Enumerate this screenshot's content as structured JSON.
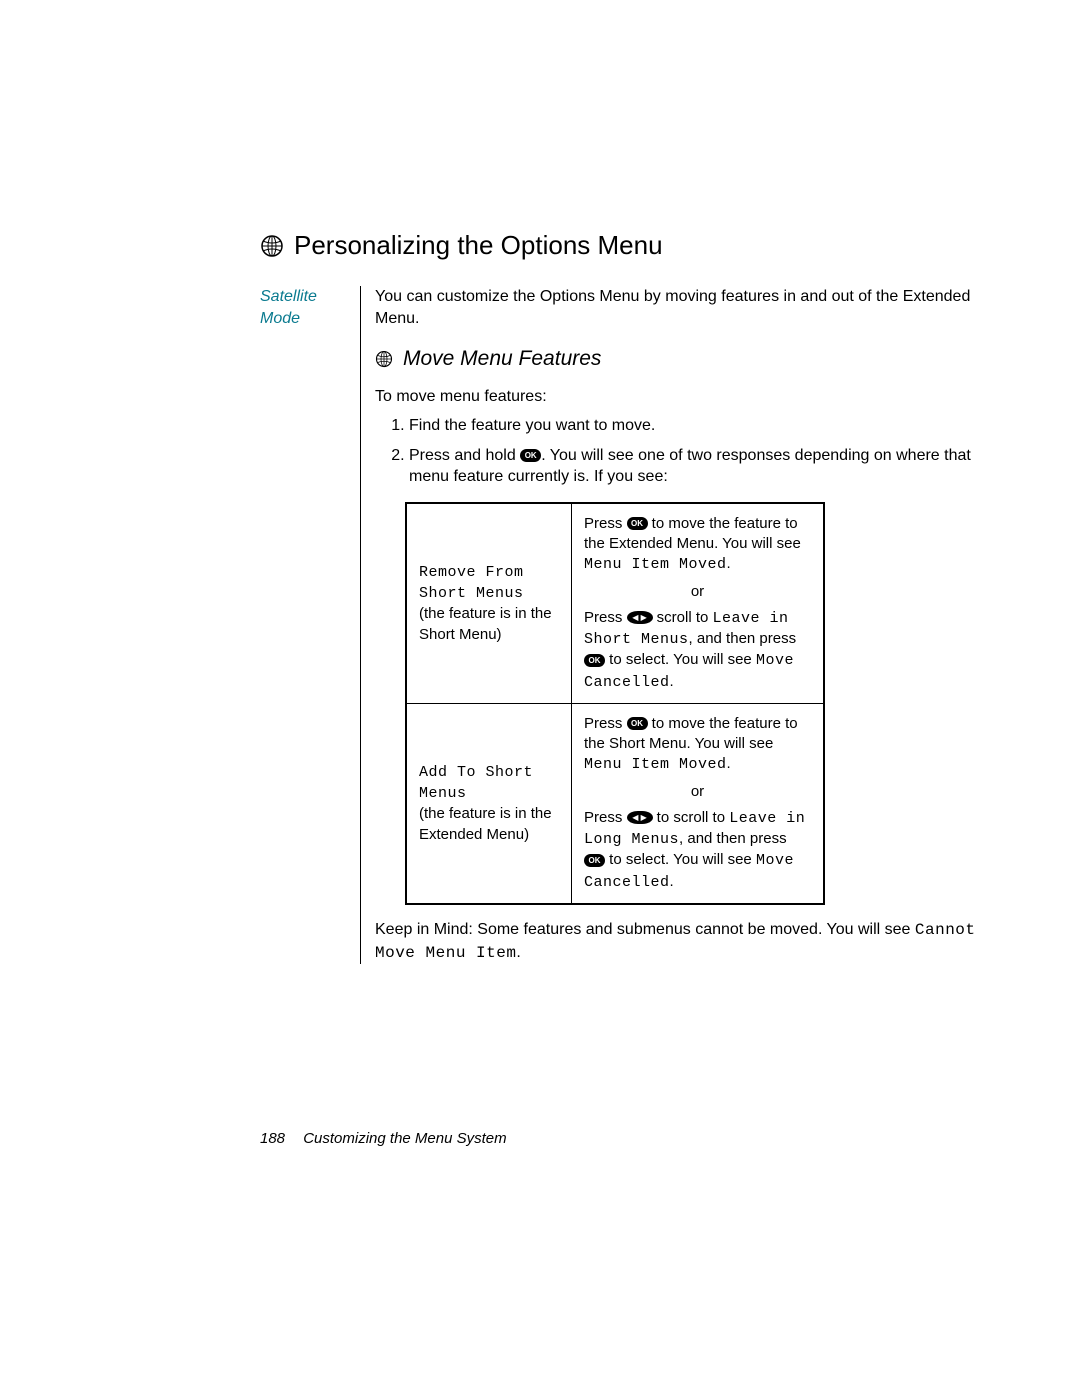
{
  "heading": "Personalizing the Options Menu",
  "sidebar": "Satellite Mode",
  "intro": "You can customize the Options Menu by moving features in and out of the Extended Menu.",
  "subheading": "Move Menu Features",
  "lead": "To move menu features:",
  "steps": {
    "s1": "Find the feature   you want to move.",
    "s2a": "Press and hold ",
    "s2b": ". You will see one of two responses depending on where that menu feature currently is. If you see:"
  },
  "ok_label": "OK",
  "scroll_label": "◀ ▶",
  "table": {
    "r1_left_mono": "Remove From Short Menus",
    "r1_left_note": "(the feature is in the Short Menu)",
    "r1_a1": "Press ",
    "r1_a2": " to move the feature to the Extended Menu. You will see ",
    "r1_a_mono": "Menu Item Moved",
    "r1_a3": ".",
    "or": "or",
    "r1_b1": "Press ",
    "r1_b2": " scroll to ",
    "r1_b_mono1": "Leave in Short Menus",
    "r1_b3": ", and then press ",
    "r1_b4": " to select. You will see ",
    "r1_b_mono2": "Move Cancelled",
    "r1_b5": ".",
    "r2_left_mono": "Add To Short Menus",
    "r2_left_note": "(the feature is in the Extended Menu)",
    "r2_a1": "Press ",
    "r2_a2": " to move the feature to the Short Menu. You will see ",
    "r2_a_mono": "Menu Item Moved",
    "r2_a3": ".",
    "r2_b1": "Press ",
    "r2_b2": " to scroll to ",
    "r2_b_mono1": "Leave in Long Menus",
    "r2_b3": ", and then press ",
    "r2_b4": " to select. You will see ",
    "r2_b_mono2": "Move Cancelled",
    "r2_b5": "."
  },
  "note_a": "Keep in Mind:  Some features and submenus cannot be moved. You will see ",
  "note_mono": "Cannot Move Menu Item",
  "note_b": ".",
  "footer_page": "188",
  "footer_text": "Customizing the Menu System"
}
